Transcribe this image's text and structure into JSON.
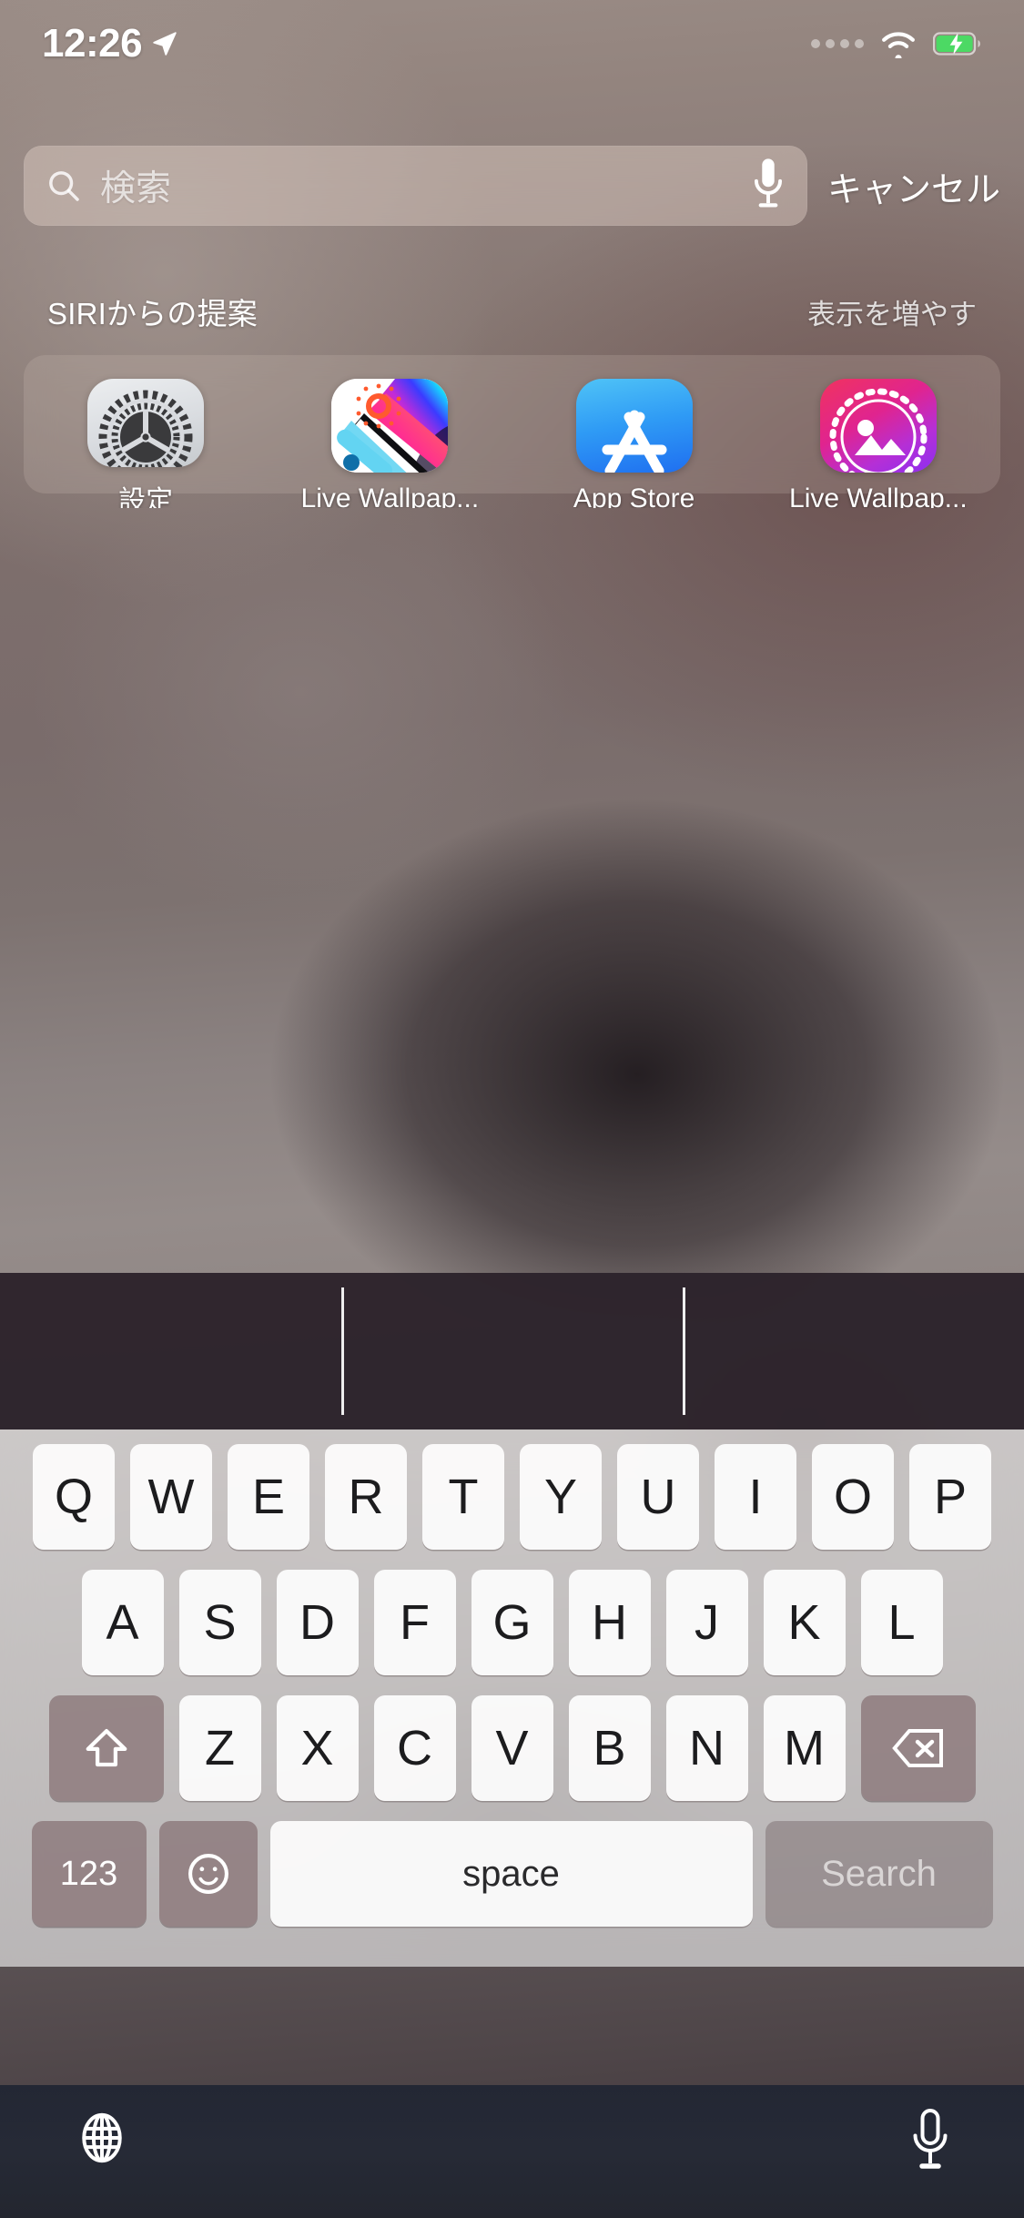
{
  "status_bar": {
    "time": "12:26",
    "location_icon": "location-arrow-icon",
    "signal_icon": "signal-dots-icon",
    "wifi_icon": "wifi-icon",
    "battery_icon": "battery-charging-icon",
    "battery_color": "#4cd964"
  },
  "search": {
    "placeholder": "検索",
    "value": "",
    "search_icon": "search-icon",
    "mic_icon": "microphone-icon",
    "cancel_label": "キャンセル"
  },
  "siri": {
    "section_title": "SIRIからの提案",
    "show_more_label": "表示を増やす",
    "apps": [
      {
        "label": "設定",
        "icon": "settings-gear-icon"
      },
      {
        "label": "Live Wallpap...",
        "icon": "live-wallpaper-squeegee-icon"
      },
      {
        "label": "App Store",
        "icon": "app-store-icon"
      },
      {
        "label": "Live Wallpap...",
        "icon": "live-wallpaper-photo-icon"
      }
    ]
  },
  "predictive_bar": {
    "suggestions": [
      "",
      "",
      ""
    ]
  },
  "keyboard": {
    "row1": [
      "Q",
      "W",
      "E",
      "R",
      "T",
      "Y",
      "U",
      "I",
      "O",
      "P"
    ],
    "row2": [
      "A",
      "S",
      "D",
      "F",
      "G",
      "H",
      "J",
      "K",
      "L"
    ],
    "row3": [
      "Z",
      "X",
      "C",
      "V",
      "B",
      "N",
      "M"
    ],
    "shift_icon": "shift-arrow-icon",
    "delete_icon": "backspace-delete-icon",
    "numbers_label": "123",
    "emoji_icon": "emoji-smiley-icon",
    "space_label": "space",
    "search_label": "Search"
  },
  "bottom_bar": {
    "globe_icon": "globe-language-icon",
    "dictation_icon": "microphone-dictation-icon"
  },
  "colors": {
    "accent_green": "#4cd964",
    "keyboard_bg": "#f6f5f5",
    "modifier_key": "#8c787a",
    "predictive_bg": "#2c232b",
    "bottom_bar_bg": "#262a36"
  }
}
